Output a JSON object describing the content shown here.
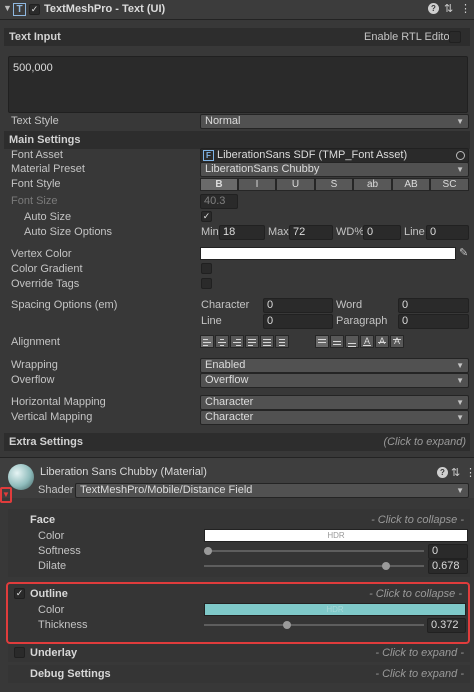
{
  "component": {
    "title": "TextMeshPro - Text (UI)",
    "enabled": true
  },
  "text_input": {
    "header": "Text Input",
    "rtl_label": "Enable RTL Editor",
    "value": "500,000"
  },
  "text_style": {
    "label": "Text Style",
    "value": "Normal"
  },
  "main_settings": {
    "header": "Main Settings",
    "font_asset": {
      "label": "Font Asset",
      "value": "LiberationSans SDF (TMP_Font Asset)"
    },
    "material_preset": {
      "label": "Material Preset",
      "value": "LiberationSans Chubby"
    },
    "font_style": {
      "label": "Font Style",
      "buttons": [
        "B",
        "I",
        "U",
        "S",
        "ab",
        "AB",
        "SC"
      ]
    },
    "font_size": {
      "label": "Font Size",
      "value": "40.3"
    },
    "auto_size": {
      "label": "Auto Size",
      "checked": true
    },
    "auto_size_options": {
      "label": "Auto Size Options",
      "min_label": "Min",
      "min": "18",
      "max_label": "Max",
      "max": "72",
      "wd_label": "WD%",
      "wd": "0",
      "line_label": "Line",
      "line": "0"
    },
    "vertex_color": {
      "label": "Vertex Color"
    },
    "color_gradient": {
      "label": "Color Gradient"
    },
    "override_tags": {
      "label": "Override Tags"
    },
    "spacing": {
      "label": "Spacing Options (em)",
      "character_label": "Character",
      "character": "0",
      "word_label": "Word",
      "word": "0",
      "line_label": "Line",
      "line": "0",
      "paragraph_label": "Paragraph",
      "paragraph": "0"
    },
    "alignment": {
      "label": "Alignment"
    },
    "wrapping": {
      "label": "Wrapping",
      "value": "Enabled"
    },
    "overflow": {
      "label": "Overflow",
      "value": "Overflow"
    },
    "horizontal_mapping": {
      "label": "Horizontal Mapping",
      "value": "Character"
    },
    "vertical_mapping": {
      "label": "Vertical Mapping",
      "value": "Character"
    }
  },
  "extra_settings": {
    "header": "Extra Settings",
    "hint": "(Click to expand)"
  },
  "material": {
    "title": "Liberation Sans Chubby (Material)",
    "shader_label": "Shader",
    "shader": "TextMeshPro/Mobile/Distance Field",
    "face": {
      "header": "Face",
      "hint": "- Click to collapse -",
      "color_label": "Color",
      "hdr": "HDR",
      "softness_label": "Softness",
      "softness": "0",
      "dilate_label": "Dilate",
      "dilate": "0.678"
    },
    "outline": {
      "header": "Outline",
      "hint": "- Click to collapse -",
      "enabled": true,
      "color_label": "Color",
      "hdr": "HDR",
      "thickness_label": "Thickness",
      "thickness": "0.372"
    },
    "underlay": {
      "header": "Underlay",
      "hint": "- Click to expand -"
    },
    "debug": {
      "header": "Debug Settings",
      "hint": "- Click to expand -"
    }
  },
  "colors": {
    "highlight": "#e03c3c",
    "outline_color": "#7fc9c9",
    "face_color": "#ffffff"
  }
}
